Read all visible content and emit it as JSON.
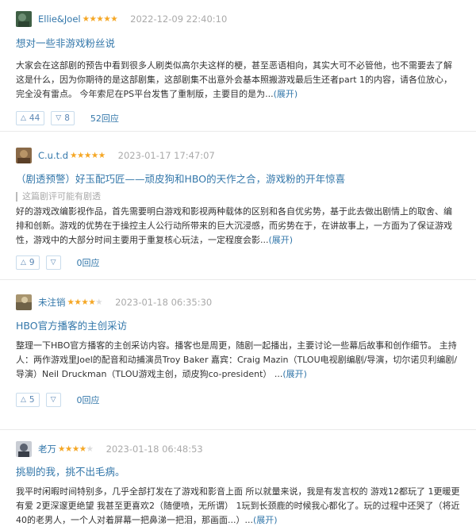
{
  "reviews": [
    {
      "author": "Ellie&Joel",
      "stars": 5,
      "time": "2022-12-09 22:40:10",
      "title": "想对一些非游戏粉丝说",
      "spoiler": "",
      "body": "大家会在这部剧的预告中看到很多人刷类似高尔夫这样的梗，甚至恶语相向，其实大可不必管他，也不需要去了解这是什么，因为你期待的是这部剧集，这部剧集不出意外会基本照搬游戏最后生还者part 1的内容，请各位放心，完全没有雷点。 今年索尼在PS平台发售了重制版，主要目的是为...",
      "expand": "(展开)",
      "up": "44",
      "down": "8",
      "replies": "52回应",
      "avatar_color": "#4a6b4f"
    },
    {
      "author": "C.u.t.d",
      "stars": 5,
      "time": "2023-01-17 17:47:07",
      "title": "（剧透预警）好玉配巧匠——顽皮狗和HBO的天作之合，游戏粉的开年惊喜",
      "spoiler": "这篇剧评可能有剧透",
      "body": "好的游戏改编影视作品，首先需要明白游戏和影视两种载体的区别和各自优劣势，基于此去做出剧情上的取舍、编排和创新。游戏的优势在于操控主人公行动所带来的巨大沉浸感，而劣势在于，在讲故事上，一方面为了保证游戏性，游戏中的大部分时间主要用于重复核心玩法，一定程度会影...",
      "expand": "(展开)",
      "up": "9",
      "down": "",
      "replies": "0回应",
      "avatar_color": "#7a5a3c"
    },
    {
      "author": "未注销",
      "stars": 4,
      "time": "2023-01-18 06:35:30",
      "title": "HBO官方播客的主创采访",
      "spoiler": "",
      "body": "整理一下HBO官方播客的主创采访内容。播客也是周更，随剧一起播出，主要讨论一些幕后故事和创作细节。 主持人：两作游戏里Joel的配音和动捕演员Troy Baker 嘉宾：Craig Mazin（TLOU电视剧编剧/导演，切尔诺贝利编剧/导演）Neil Druckman（TLOU游戏主创，顽皮狗co-president） ...",
      "expand": "(展开)",
      "up": "5",
      "down": "",
      "replies": "0回应",
      "avatar_color": "#8c7a5e"
    },
    {
      "author": "老万",
      "stars": 4,
      "time": "2023-01-18 06:48:53",
      "title": "挑剔的我，挑不出毛病。",
      "spoiler": "",
      "body": "我平时闲暇时间特别多，几乎全部打发在了游戏和影音上面 所以就量来说，我是有发言权的 游戏12都玩了 1更暖更有爱 2更深邃更绝望 我甚至更喜欢2（随便喷，无所谓） 1玩到长颈鹿的时候我心都化了。玩的过程中还哭了（将近40的老男人，一个人对着屏幕一把鼻涕一把泪，那画面...）...",
      "expand": "(展开)",
      "up": "",
      "down": "",
      "replies": "",
      "avatar_color": "#5b6270"
    }
  ]
}
